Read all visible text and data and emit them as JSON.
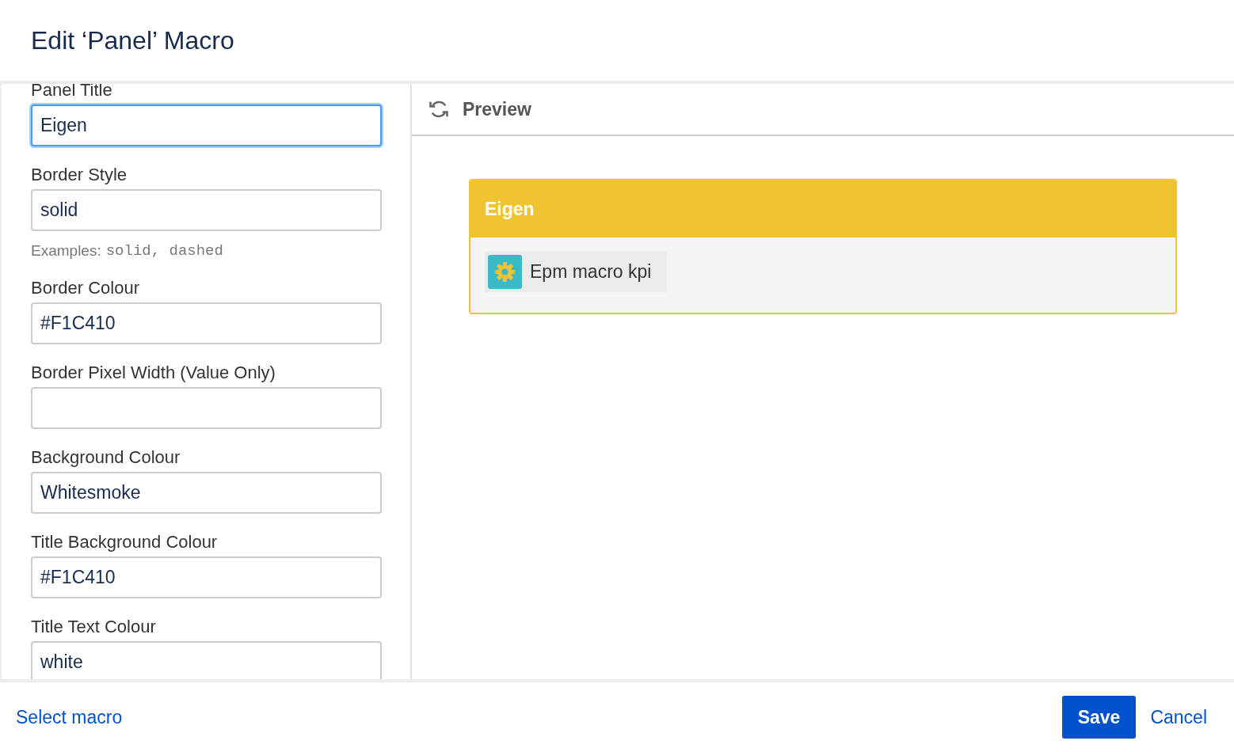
{
  "dialog": {
    "title": "Edit ‘Panel’ Macro"
  },
  "fields": [
    {
      "label": "Panel Title",
      "value": "Eigen",
      "focused": true
    },
    {
      "label": "Border Style",
      "value": "solid",
      "focused": false,
      "hint": {
        "text": "Examples:",
        "code": "solid, dashed"
      }
    },
    {
      "label": "Border Colour",
      "value": "#F1C410",
      "focused": false
    },
    {
      "label": "Border Pixel Width (Value Only)",
      "focused": false
    },
    {
      "label": "Background Colour",
      "value": "Whitesmoke",
      "focused": false
    },
    {
      "label": "Title Background Colour",
      "value": "#F1C410",
      "focused": false
    },
    {
      "label": "Title Text Colour",
      "value": "white",
      "focused": false
    }
  ],
  "preview": {
    "heading": "Preview",
    "panel": {
      "title": "Eigen",
      "macro": "Epm macro kpi"
    }
  },
  "footer": {
    "link": "Select macro",
    "buttons": [
      {
        "label": "Save",
        "kind": "primary"
      },
      {
        "label": "Cancel",
        "kind": "link"
      }
    ]
  }
}
